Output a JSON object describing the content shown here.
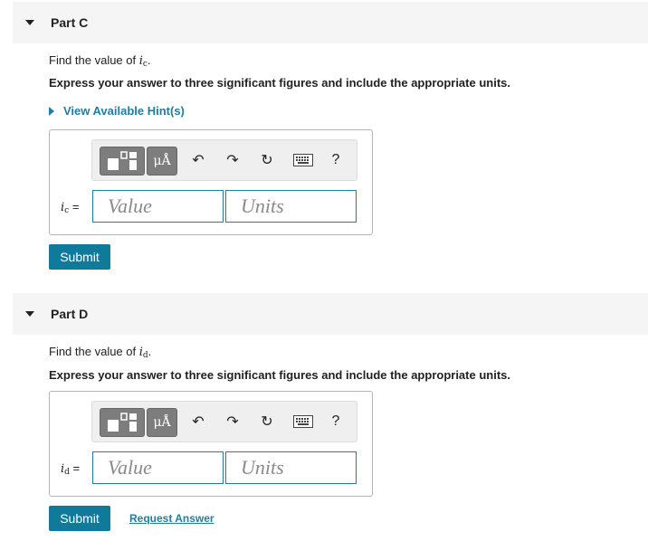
{
  "partC": {
    "title": "Part C",
    "prompt_prefix": "Find the value of ",
    "var_main": "i",
    "var_sub": "c",
    "prompt_suffix": ".",
    "instruction": "Express your answer to three significant figures and include the appropriate units.",
    "hint_label": "View Available Hint(s)",
    "label_eq": " =",
    "value_placeholder": "Value",
    "units_placeholder": "Units",
    "submit_label": "Submit"
  },
  "partD": {
    "title": "Part D",
    "prompt_prefix": "Find the value of ",
    "var_main": "i",
    "var_sub": "d",
    "prompt_suffix": ".",
    "instruction": "Express your answer to three significant figures and include the appropriate units.",
    "label_eq": " =",
    "value_placeholder": "Value",
    "units_placeholder": "Units",
    "submit_label": "Submit",
    "request_label": "Request Answer"
  },
  "toolbar": {
    "units_label": "μÅ",
    "undo_icon": "↶",
    "redo_icon": "↷",
    "reset_icon": "↻",
    "help_label": "?"
  },
  "colors": {
    "accent": "#1e7fa0",
    "button": "#0f7a99",
    "header_bg": "#f5f5f5"
  }
}
